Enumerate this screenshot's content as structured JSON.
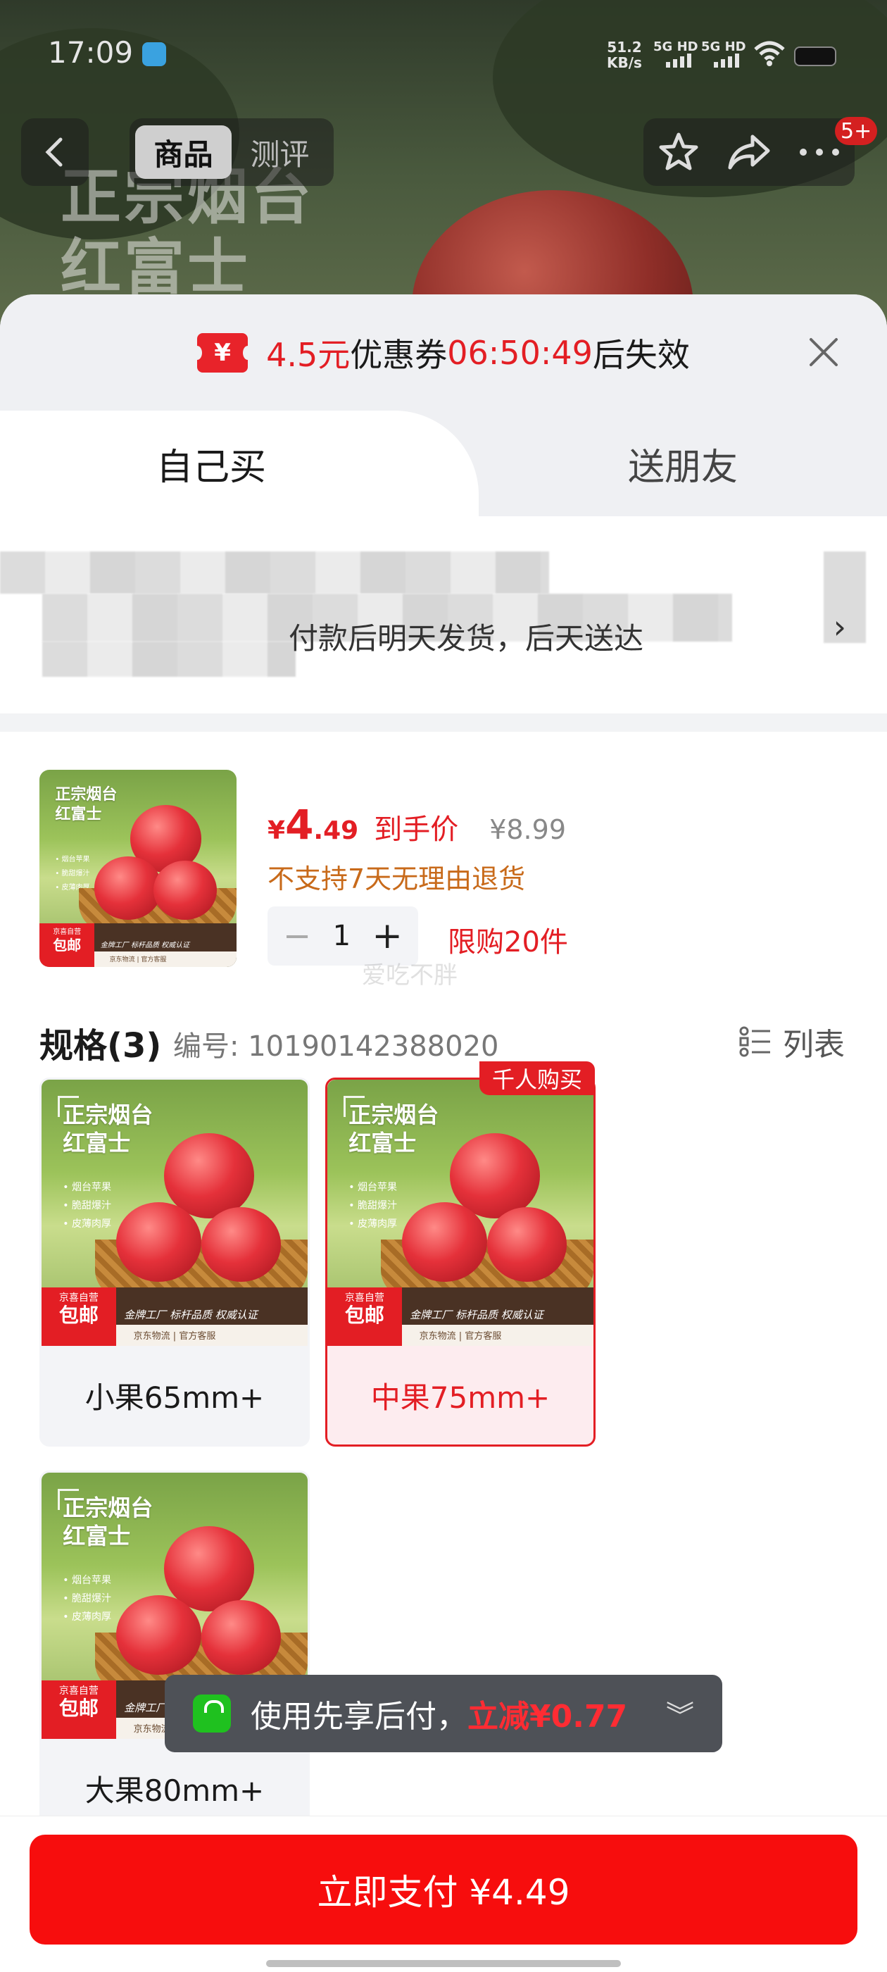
{
  "status_bar": {
    "time": "17:09",
    "net_speed_value": "51.2",
    "net_speed_unit": "KB/s",
    "sim1": "5G HD",
    "sim2": "5G HD"
  },
  "nav": {
    "tabs": [
      {
        "label": "商品",
        "active": true
      },
      {
        "label": "测评",
        "active": false
      }
    ],
    "message_badge": "5+"
  },
  "background": {
    "title_line1": "正宗烟台",
    "title_line2": "红富士"
  },
  "coupon_banner": {
    "amount": "4.5元",
    "text1": "优惠券",
    "countdown": "06:50:49",
    "text2": "后失效",
    "icon_glyph": "¥"
  },
  "purchase_tabs": {
    "self": "自己买",
    "friend": "送朋友"
  },
  "address": {
    "delivery_text": "付款后明天发货，后天送达",
    "arrow": "›"
  },
  "product": {
    "currency": "¥",
    "price_int": "4",
    "price_dec": ".49",
    "price_tag": "到手价",
    "original_price": "¥8.99",
    "return_policy": "不支持7天无理由退货",
    "quantity": "1",
    "limit": "限购20件",
    "watermark": "爱吃不胖"
  },
  "spec": {
    "title": "规格(3)",
    "number": "编号: 10190142388020",
    "list_label": "列表",
    "options": [
      {
        "label": "小果65mm+",
        "selected": false,
        "badge": ""
      },
      {
        "label": "中果75mm+",
        "selected": true,
        "badge": "千人购买"
      },
      {
        "label": "大果80mm+",
        "selected": false,
        "badge": ""
      }
    ]
  },
  "thumb": {
    "title_line1": "正宗烟台",
    "title_line2": "红富士",
    "bullets": [
      "• 烟台苹果",
      "• 脆甜爆汁",
      "• 皮薄肉厚"
    ],
    "jd_line1": "京喜自营",
    "jd_line2": "包邮",
    "badges": "金牌工厂  标杆品质  权威认证",
    "footer": "京东物流 | 官方客服"
  },
  "toast": {
    "text": "使用先享后付，",
    "highlight": "立减¥0.77",
    "chevron": "︾"
  },
  "pay_button": {
    "label": "立即支付 ¥4.49"
  },
  "colors": {
    "accent_red": "#e31e24",
    "pay_button": "#f70d0d",
    "toast_bg": "#4e5157",
    "coupon_bg": "#eff0f3"
  }
}
